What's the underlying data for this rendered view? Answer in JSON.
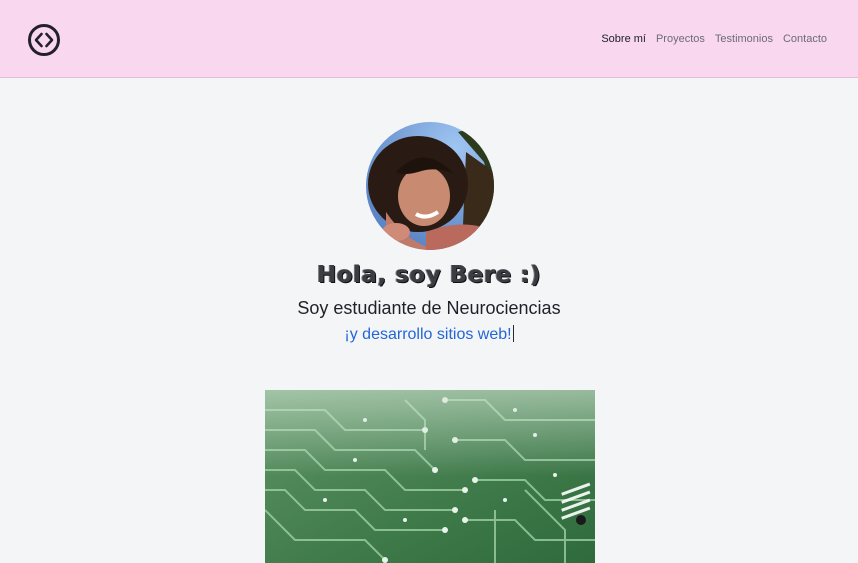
{
  "nav": {
    "logo_icon": "code-brackets-circle-icon",
    "links": [
      "Sobre mí",
      "Proyectos",
      "Testimonios",
      "Contacto"
    ],
    "active": "Sobre mí"
  },
  "hero": {
    "greeting": "Hola, soy Bere :)",
    "subtitle": "Soy estudiante de Neurociencias",
    "typed_text": "¡y desarrollo sitios web!"
  },
  "colors": {
    "navbar_bg": "#f8d7ef",
    "page_bg": "#f4f5f7",
    "accent_blue": "#2466d8"
  }
}
